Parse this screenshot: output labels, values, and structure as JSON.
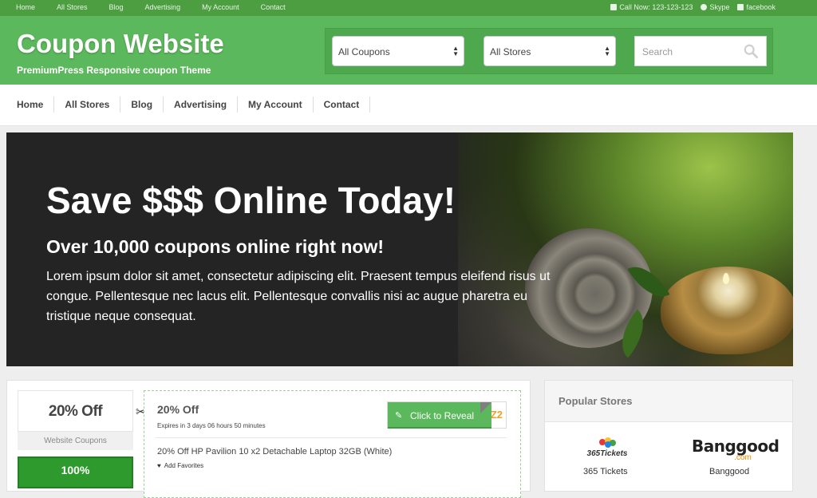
{
  "topbar": {
    "links": [
      "Home",
      "All Stores",
      "Blog",
      "Advertising",
      "My Account",
      "Contact"
    ],
    "call": "Call Now: 123-123-123",
    "skype": "Skype",
    "facebook": "facebook"
  },
  "header": {
    "title": "Coupon Website",
    "tagline": "PremiumPress Responsive coupon Theme",
    "select_coupons": "All Coupons",
    "select_stores": "All Stores",
    "search_placeholder": "Search"
  },
  "nav": {
    "items": [
      "Home",
      "All Stores",
      "Blog",
      "Advertising",
      "My Account",
      "Contact"
    ]
  },
  "hero": {
    "title": "Save $$$ Online Today!",
    "subtitle": "Over 10,000 coupons online right now!",
    "body": "Lorem ipsum dolor sit amet, consectetur adipiscing elit. Praesent tempus eleifend risus ut congue. Pellentesque nec lacus elit. Pellentesque convallis nisi ac augue pharetra eu tristique neque consequat."
  },
  "coupon": {
    "badge": "20% Off",
    "store": "Website Coupons",
    "badge2": "100%",
    "title": "20% Off",
    "expires": "Expires in 3 days 06 hours 50 minutes",
    "description": "20% Off HP Pavilion 10 x2 Detachable Laptop 32GB (White)",
    "favorites": "Add Favorites",
    "reveal_label": "Click to Reveal",
    "code_peek": "Z2"
  },
  "popular": {
    "title": "Popular Stores",
    "stores": [
      {
        "name": "365 Tickets",
        "logo_text": "365Tickets"
      },
      {
        "name": "Banggood",
        "logo_text": "Banggood",
        "logo_sub": ".com"
      }
    ]
  },
  "colors": {
    "brand_green": "#5cb85c",
    "top_green": "#4c9e41",
    "accent_orange": "#f0a020"
  }
}
